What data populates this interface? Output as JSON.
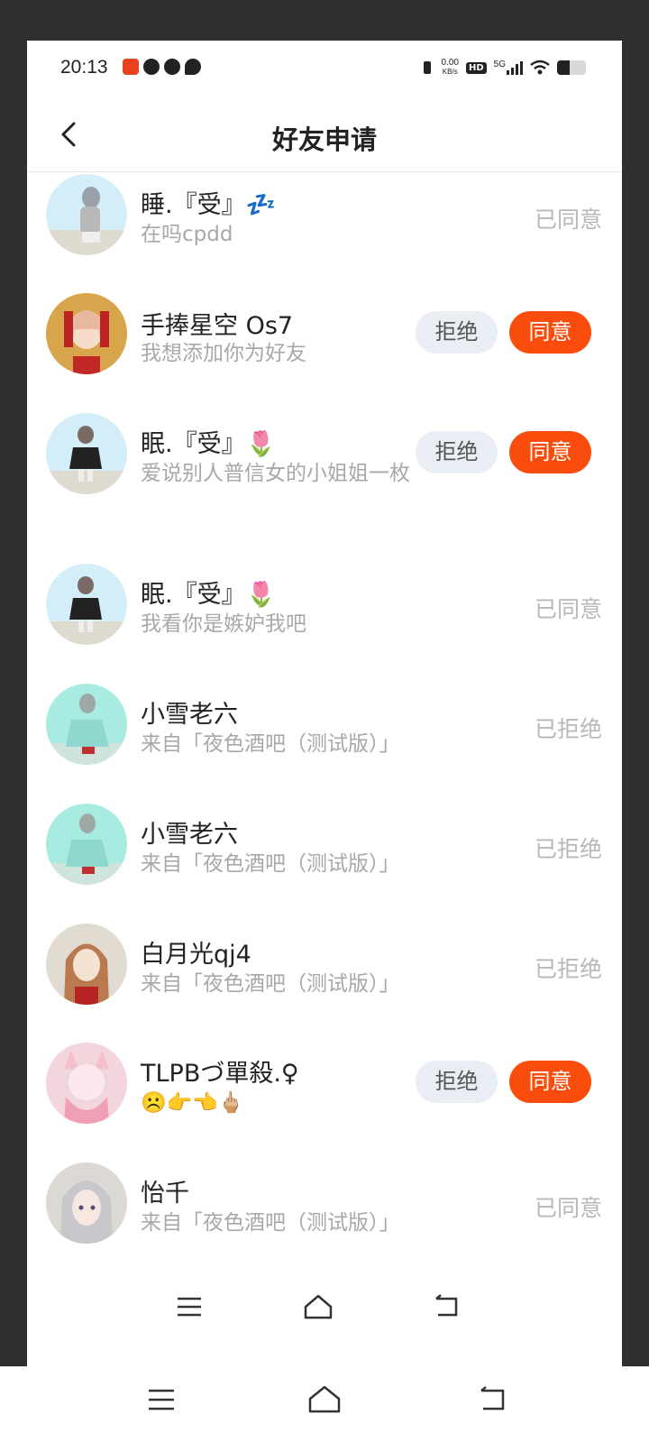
{
  "status_bar": {
    "time": "20:13",
    "net_speed_value": "0.00",
    "net_speed_unit": "KB/s",
    "hd": "HD",
    "network": "5G",
    "battery_level": 0.45
  },
  "header": {
    "title": "好友申请"
  },
  "requests": [
    {
      "name": "睡.『受』💤",
      "message": "在吗cpdd",
      "status": "已同意",
      "actions": false
    },
    {
      "name": "手捧星空 Os7",
      "message": "我想添加你为好友",
      "status": "",
      "actions": true
    },
    {
      "name": "眠.『受』🌷",
      "message": "爱说别人普信女的小姐姐一枚",
      "status": "",
      "actions": true
    },
    {
      "name": "眠.『受』🌷",
      "message": "我看你是嫉妒我吧",
      "status": "已同意",
      "actions": false
    },
    {
      "name": "小雪老六",
      "message": "来自「夜色酒吧（测试版）」",
      "status": "已拒绝",
      "actions": false
    },
    {
      "name": "小雪老六",
      "message": "来自「夜色酒吧（测试版）」",
      "status": "已拒绝",
      "actions": false
    },
    {
      "name": "白月光qj4",
      "message": "来自「夜色酒吧（测试版）」",
      "status": "已拒绝",
      "actions": false
    },
    {
      "name": "TLPBづ單殺.♀",
      "message": "☹️👉👈🖕🏼",
      "status": "",
      "actions": true
    },
    {
      "name": "怡千",
      "message": "来自「夜色酒吧（测试版）」",
      "status": "已同意",
      "actions": false
    }
  ],
  "buttons": {
    "reject": "拒绝",
    "accept": "同意"
  },
  "colors": {
    "accent": "#fa4c0c",
    "reject_bg": "#e9edf4",
    "status_gray": "#b8b8b8"
  },
  "icons": {
    "back": "chevron-left-icon",
    "menu": "menu-icon",
    "home": "home-icon",
    "return": "back-arrow-icon"
  }
}
